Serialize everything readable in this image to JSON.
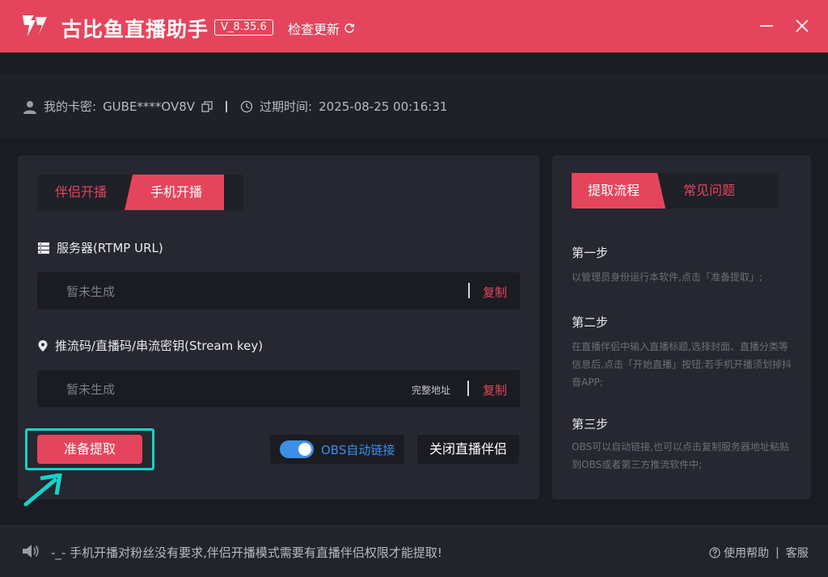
{
  "app": {
    "title": "古比鱼直播助手",
    "version": "V_8.35.6",
    "check_update": "检查更新"
  },
  "account": {
    "card_label": "我的卡密:",
    "card_value": "GUBE****OV8V",
    "expire_label": "过期时间:",
    "expire_value": "2025-08-25 00:16:31"
  },
  "left_panel": {
    "tabs": [
      {
        "label": "伴侣开播",
        "active": false
      },
      {
        "label": "手机开播",
        "active": true
      }
    ],
    "server": {
      "label": "服务器(RTMP URL)",
      "placeholder": "暂未生成",
      "copy_label": "复制"
    },
    "stream_key": {
      "label": "推流码/直播码/串流密钥(Stream key)",
      "placeholder": "暂未生成",
      "full_address_label": "完整地址",
      "copy_label": "复制"
    },
    "prepare_button": "准备提取",
    "obs_toggle": {
      "label": "OBS自动链接",
      "enabled": true
    },
    "close_companion_button": "关闭直播伴侣"
  },
  "right_panel": {
    "tabs": [
      {
        "label": "提取流程",
        "active": true
      },
      {
        "label": "常见问题",
        "active": false
      }
    ],
    "steps": [
      {
        "title": "第一步",
        "text": "以管理员身份运行本软件,点击「准备提取」;"
      },
      {
        "title": "第二步",
        "text": "在直播伴侣中输入直播标题,选择封面、直播分类等信息后,点击「开始直播」按钮;若手机开播须划掉抖音APP;"
      },
      {
        "title": "第三步",
        "text": "OBS可以自动链接,也可以点击复制服务器地址粘贴到OBS或者第三方推流软件中;"
      }
    ]
  },
  "footer": {
    "notice": "-_- 手机开播对粉丝没有要求,伴侣开播模式需要有直播伴侣权限才能提取!",
    "help_label": "使用帮助",
    "support_label": "客服"
  },
  "colors": {
    "accent": "#e5455c",
    "obs_blue": "#3b8fe6",
    "highlight": "#15d3c8"
  }
}
